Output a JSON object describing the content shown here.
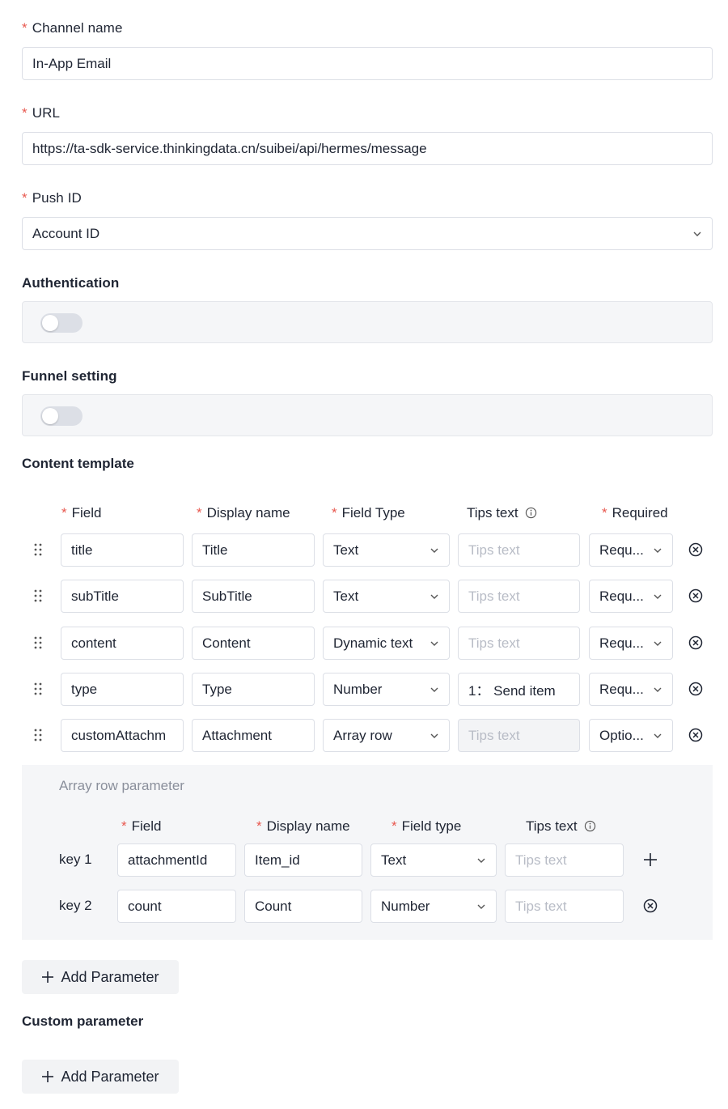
{
  "fields": {
    "channel_name": {
      "label": "Channel name",
      "value": "In-App Email"
    },
    "url": {
      "label": "URL",
      "value": "https://ta-sdk-service.thinkingdata.cn/suibei/api/hermes/message"
    },
    "push_id": {
      "label": "Push ID",
      "value": "Account ID"
    },
    "authentication": {
      "label": "Authentication"
    },
    "funnel_setting": {
      "label": "Funnel setting"
    }
  },
  "content_template": {
    "title": "Content template",
    "headers": {
      "field": "Field",
      "display_name": "Display name",
      "field_type": "Field Type",
      "tips_text": "Tips text",
      "required": "Required"
    },
    "rows": [
      {
        "field": "title",
        "display_name": "Title",
        "field_type": "Text",
        "tips": "Tips text",
        "tips_placeholder": true,
        "required": "Requ..."
      },
      {
        "field": "subTitle",
        "display_name": "SubTitle",
        "field_type": "Text",
        "tips": "Tips text",
        "tips_placeholder": true,
        "required": "Requ..."
      },
      {
        "field": "content",
        "display_name": "Content",
        "field_type": "Dynamic text",
        "tips": "Tips text",
        "tips_placeholder": true,
        "required": "Requ..."
      },
      {
        "field": "type",
        "display_name": "Type",
        "field_type": "Number",
        "tips": "1： Send item",
        "tips_placeholder": false,
        "required": "Requ..."
      },
      {
        "field": "customAttachm",
        "display_name": "Attachment",
        "field_type": "Array row",
        "tips": "Tips text",
        "tips_placeholder": true,
        "tips_disabled": true,
        "required": "Optio..."
      }
    ]
  },
  "array_row": {
    "title": "Array row parameter",
    "headers": {
      "field": "Field",
      "display_name": "Display name",
      "field_type": "Field type",
      "tips_text": "Tips text"
    },
    "rows": [
      {
        "key": "key 1",
        "field": "attachmentId",
        "display_name": "Item_id",
        "field_type": "Text",
        "tips": "Tips text"
      },
      {
        "key": "key 2",
        "field": "count",
        "display_name": "Count",
        "field_type": "Number",
        "tips": "Tips text"
      }
    ]
  },
  "buttons": {
    "add_parameter": "Add Parameter",
    "add_parameter_custom": "Add Parameter"
  },
  "custom_parameter": {
    "title": "Custom parameter"
  },
  "colors": {
    "required_star": "#e8584f",
    "border": "#dcdfe6",
    "panel_bg": "#f5f6f8"
  }
}
